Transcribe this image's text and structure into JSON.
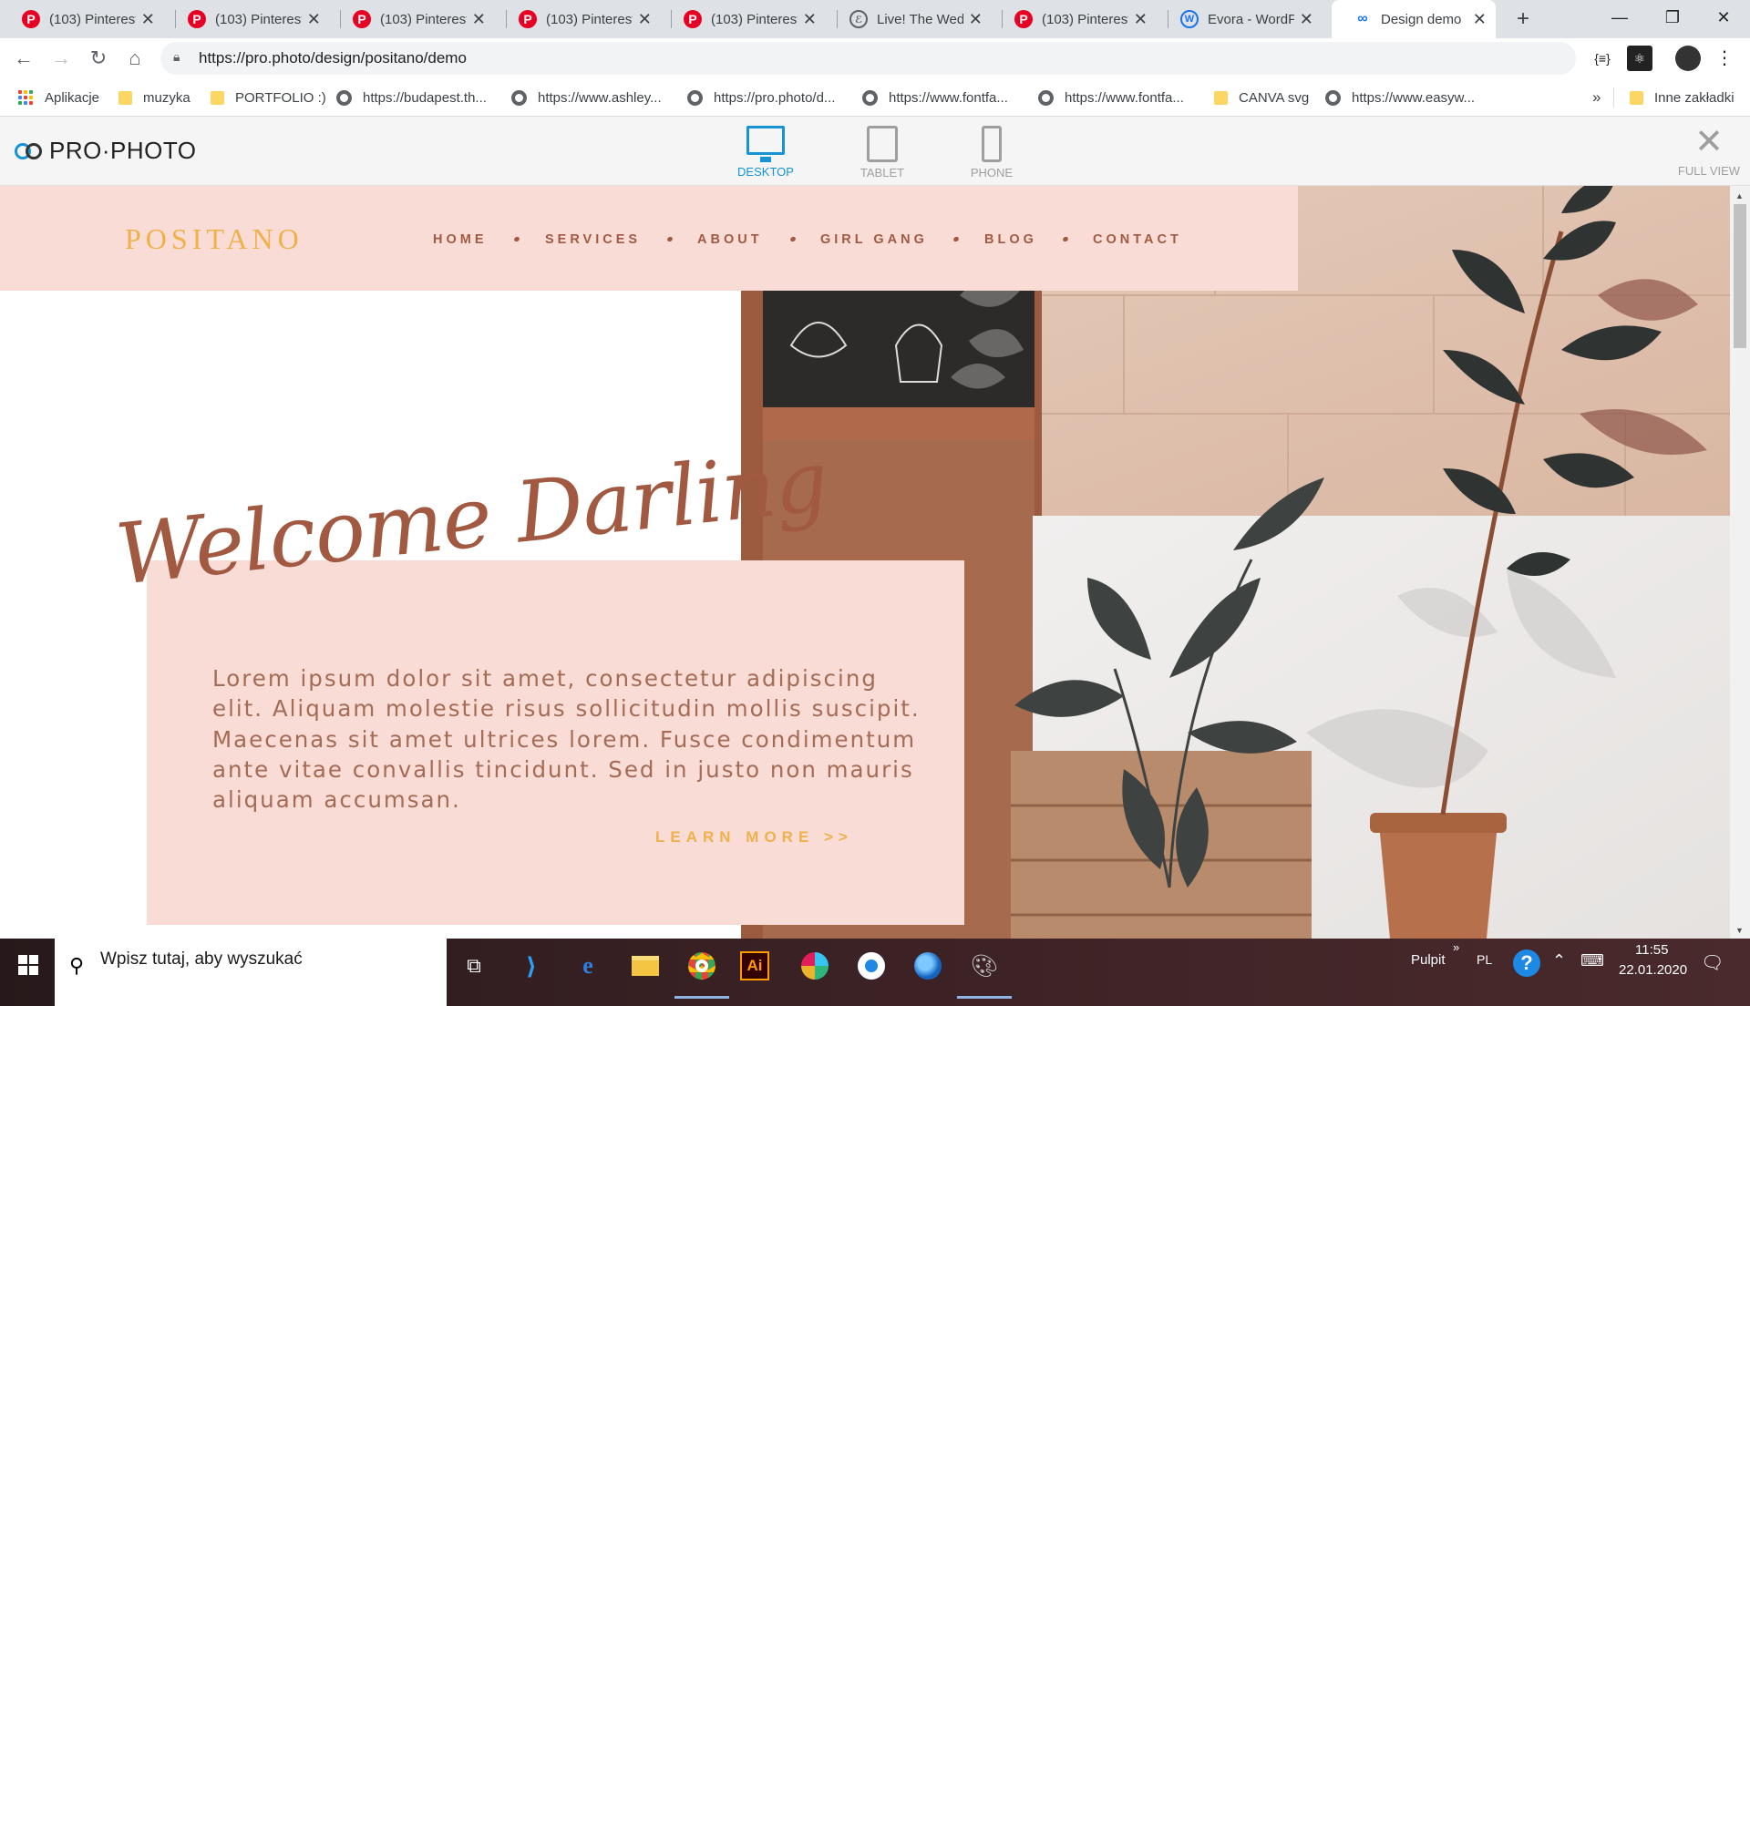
{
  "browser": {
    "tabs": [
      {
        "title": "(103) Pinterest",
        "icon": "pinterest-icon"
      },
      {
        "title": "(103) Pinterest",
        "icon": "pinterest-icon"
      },
      {
        "title": "(103) Pinterest",
        "icon": "pinterest-icon"
      },
      {
        "title": "(103) Pinterest",
        "icon": "pinterest-icon"
      },
      {
        "title": "(103) Pinterest",
        "icon": "pinterest-icon"
      },
      {
        "title": "Live! The Wedd",
        "icon": "script-e-icon"
      },
      {
        "title": "(103) Pinterest",
        "icon": "pinterest-icon"
      },
      {
        "title": "Evora - WordPr",
        "icon": "wordpress-icon"
      },
      {
        "title": "Design demo",
        "icon": "prophoto-link-icon"
      }
    ],
    "url": "https://pro.photo/design/positano/demo",
    "bookmarks": [
      {
        "label": "Aplikacje",
        "icon": "apps-grid-icon"
      },
      {
        "label": "muzyka",
        "icon": "folder-icon"
      },
      {
        "label": "PORTFOLIO :)",
        "icon": "folder-icon"
      },
      {
        "label": "https://budapest.th...",
        "icon": "globe-icon"
      },
      {
        "label": "https://www.ashley...",
        "icon": "globe-icon"
      },
      {
        "label": "https://pro.photo/d...",
        "icon": "globe-icon"
      },
      {
        "label": "https://www.fontfa...",
        "icon": "globe-icon"
      },
      {
        "label": "https://www.fontfa...",
        "icon": "globe-icon"
      },
      {
        "label": "CANVA svg",
        "icon": "folder-icon"
      },
      {
        "label": "https://www.easyw...",
        "icon": "globe-icon"
      }
    ],
    "bookmarks_overflow": "»",
    "other_bookmarks": "Inne zakładki"
  },
  "demobar": {
    "brand": "PRO·PHOTO",
    "devices": [
      {
        "label": "DESKTOP",
        "active": true
      },
      {
        "label": "TABLET",
        "active": false
      },
      {
        "label": "PHONE",
        "active": false
      }
    ],
    "full_view": "FULL VIEW"
  },
  "site": {
    "logo": "POSITANO",
    "nav": [
      "HOME",
      "SERVICES",
      "ABOUT",
      "GIRL GANG",
      "BLOG",
      "CONTACT"
    ],
    "heading": "Welcome Darling",
    "body": "Lorem ipsum dolor sit amet, consectetur adipiscing elit. Aliquam molestie risus sollicitudin mollis suscipit. Maecenas sit amet ultrices lorem. Fusce condimentum ante vitae convallis tincidunt. Sed in justo non mauris aliquam accumsan.",
    "cta": "LEARN MORE >>"
  },
  "taskbar": {
    "search_placeholder": "Wpisz tutaj, aby wyszukać",
    "desktop_label": "Pulpit",
    "desktop_chevron": "»",
    "language": "PL",
    "time": "11:55",
    "date": "22.01.2020"
  },
  "colors": {
    "blush": "#fadcd6",
    "rust": "#a15a41",
    "mustard": "#f0b04a",
    "accent_blue": "#1593d5"
  }
}
